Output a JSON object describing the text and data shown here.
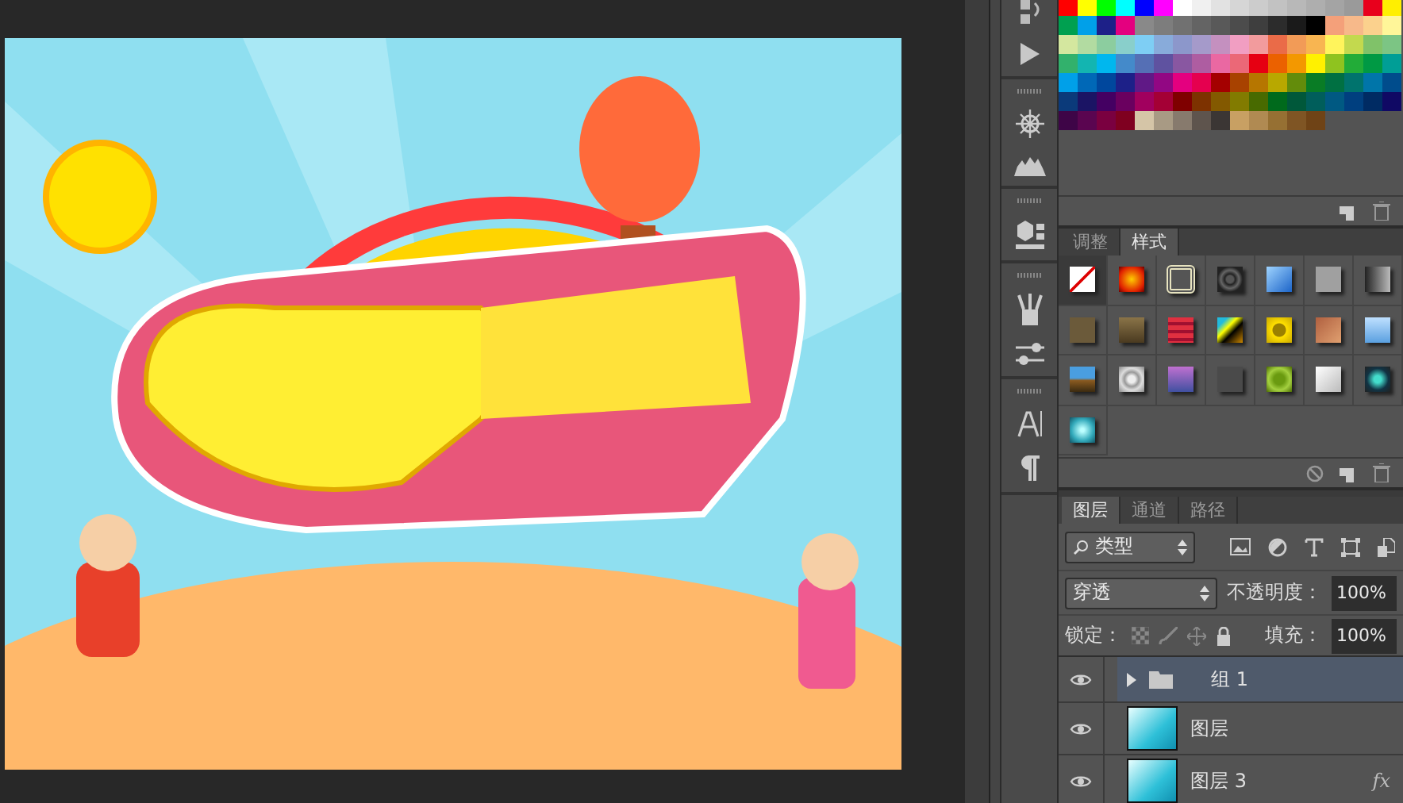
{
  "swatches": [
    {
      "color": "#ff0000"
    },
    {
      "color": "#ffff00"
    },
    {
      "color": "#00ff00"
    },
    {
      "color": "#00ffff"
    },
    {
      "color": "#0000ff"
    },
    {
      "color": "#ff00ff"
    },
    {
      "color": "#ffffff"
    },
    {
      "color": "#f0f0f0"
    },
    {
      "color": "#e2e2e2"
    },
    {
      "color": "#d6d6d6"
    },
    {
      "color": "#cccccc"
    },
    {
      "color": "#c2c2c2"
    },
    {
      "color": "#b8b8b8"
    },
    {
      "color": "#aeaeae"
    },
    {
      "color": "#a4a4a4"
    },
    {
      "color": "#9a9a9a"
    },
    {
      "color": "#e8001c"
    },
    {
      "color": "#ffef00"
    },
    {
      "color": "#00a050"
    },
    {
      "color": "#00a0e9"
    },
    {
      "color": "#1d2088"
    },
    {
      "color": "#e4007f"
    },
    {
      "color": "#898989"
    },
    {
      "color": "#7d7d7d"
    },
    {
      "color": "#717171"
    },
    {
      "color": "#646464"
    },
    {
      "color": "#595959"
    },
    {
      "color": "#4c4c4c"
    },
    {
      "color": "#3e3e3e"
    },
    {
      "color": "#2c2c2c"
    },
    {
      "color": "#1a1a1a"
    },
    {
      "color": "#000000"
    },
    {
      "color": "#f4a07a"
    },
    {
      "color": "#f7b98a"
    },
    {
      "color": "#fbd18d"
    },
    {
      "color": "#fff699"
    },
    {
      "color": "#d4e79f"
    },
    {
      "color": "#b2dba1"
    },
    {
      "color": "#8ccd9f"
    },
    {
      "color": "#89cfcb"
    },
    {
      "color": "#7ecef4"
    },
    {
      "color": "#88abda"
    },
    {
      "color": "#8c97cb"
    },
    {
      "color": "#a59aca"
    },
    {
      "color": "#c490bf"
    },
    {
      "color": "#f19ec2"
    },
    {
      "color": "#f29b9d"
    },
    {
      "color": "#ea6b48"
    },
    {
      "color": "#f29b57"
    },
    {
      "color": "#f8b551"
    },
    {
      "color": "#fff45c"
    },
    {
      "color": "#c3d94e"
    },
    {
      "color": "#80c269"
    },
    {
      "color": "#7cc584"
    },
    {
      "color": "#32b16c"
    },
    {
      "color": "#13b5b1"
    },
    {
      "color": "#00b7ee"
    },
    {
      "color": "#448aca"
    },
    {
      "color": "#556fb5"
    },
    {
      "color": "#5f52a0"
    },
    {
      "color": "#8957a1"
    },
    {
      "color": "#ae5da1"
    },
    {
      "color": "#ea68a2"
    },
    {
      "color": "#eb6877"
    },
    {
      "color": "#e60012"
    },
    {
      "color": "#eb6100"
    },
    {
      "color": "#f39800"
    },
    {
      "color": "#fff100"
    },
    {
      "color": "#8fc31f"
    },
    {
      "color": "#22ac38"
    },
    {
      "color": "#009944"
    },
    {
      "color": "#009e96"
    },
    {
      "color": "#00a0e9"
    },
    {
      "color": "#0068b7"
    },
    {
      "color": "#00479d"
    },
    {
      "color": "#1d2088"
    },
    {
      "color": "#601986"
    },
    {
      "color": "#920783"
    },
    {
      "color": "#e4007f"
    },
    {
      "color": "#e5004f"
    },
    {
      "color": "#a40000"
    },
    {
      "color": "#a84200"
    },
    {
      "color": "#b67600"
    },
    {
      "color": "#b8a800"
    },
    {
      "color": "#638c0b"
    },
    {
      "color": "#097c25"
    },
    {
      "color": "#007042"
    },
    {
      "color": "#00736d"
    },
    {
      "color": "#0075a9"
    },
    {
      "color": "#004c8c"
    },
    {
      "color": "#0b3a7a"
    },
    {
      "color": "#1b1464"
    },
    {
      "color": "#440062"
    },
    {
      "color": "#6a005f"
    },
    {
      "color": "#a1005e"
    },
    {
      "color": "#a40035"
    },
    {
      "color": "#7f0000"
    },
    {
      "color": "#7d3200"
    },
    {
      "color": "#835900"
    },
    {
      "color": "#827b00"
    },
    {
      "color": "#486a00"
    },
    {
      "color": "#006a1c"
    },
    {
      "color": "#00583a"
    },
    {
      "color": "#005e5b"
    },
    {
      "color": "#005982"
    },
    {
      "color": "#003f7f"
    },
    {
      "color": "#002b63"
    },
    {
      "color": "#100964"
    },
    {
      "color": "#3e0547"
    },
    {
      "color": "#5a0550"
    },
    {
      "color": "#7a0040"
    },
    {
      "color": "#7f0020"
    },
    {
      "color": "#d5c5a7"
    },
    {
      "color": "#a89a84"
    },
    {
      "color": "#877a6d"
    },
    {
      "color": "#5e544d"
    },
    {
      "color": "#3b3634"
    },
    {
      "color": "#c8a063"
    },
    {
      "color": "#b08a52"
    },
    {
      "color": "#967033"
    },
    {
      "color": "#7f5524"
    },
    {
      "color": "#6f4316"
    }
  ],
  "style_tabs": [
    {
      "label": "调整",
      "selected": false
    },
    {
      "label": "样式",
      "selected": true
    }
  ],
  "layer_tabs": [
    {
      "label": "图层",
      "selected": true
    },
    {
      "label": "通道",
      "selected": false
    },
    {
      "label": "路径",
      "selected": false
    }
  ],
  "filter": {
    "value": "类型"
  },
  "blend_mode": {
    "value": "穿透"
  },
  "opacity": {
    "label": "不透明度：",
    "value": "100%"
  },
  "lock": {
    "label": "锁定："
  },
  "fill": {
    "label": "填充：",
    "value": "100%"
  },
  "layers": [
    {
      "kind": "group",
      "name": "组 1",
      "selected": true,
      "visible": true
    },
    {
      "kind": "layer",
      "name": "图层",
      "selected": false,
      "visible": true
    },
    {
      "kind": "layer",
      "name": "图层 3",
      "selected": false,
      "visible": true,
      "effects": "fx"
    }
  ]
}
